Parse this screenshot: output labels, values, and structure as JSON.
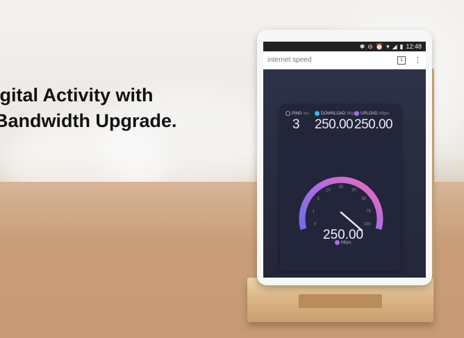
{
  "headline": {
    "line1": "igital Activity with",
    "line2": "Bandwidth Upgrade."
  },
  "status_bar": {
    "time": "12:48"
  },
  "browser": {
    "url_text": "internet speed",
    "tab_count": "1"
  },
  "metrics": {
    "ping": {
      "label": "PING",
      "unit": "ms",
      "value": "3"
    },
    "download": {
      "label": "DOWNLOAD",
      "unit": "Mbps",
      "value": "250.00"
    },
    "upload": {
      "label": "UPLOAD",
      "unit": "Mbps",
      "value": "250.00"
    }
  },
  "gauge": {
    "ticks": [
      "0",
      "1",
      "5",
      "10",
      "20",
      "30",
      "50",
      "75",
      "100"
    ],
    "current_value": "250.00",
    "unit": "Mbps",
    "colors": {
      "start": "#6f6ee8",
      "mid": "#b36de0",
      "end": "#f06ab8"
    }
  }
}
